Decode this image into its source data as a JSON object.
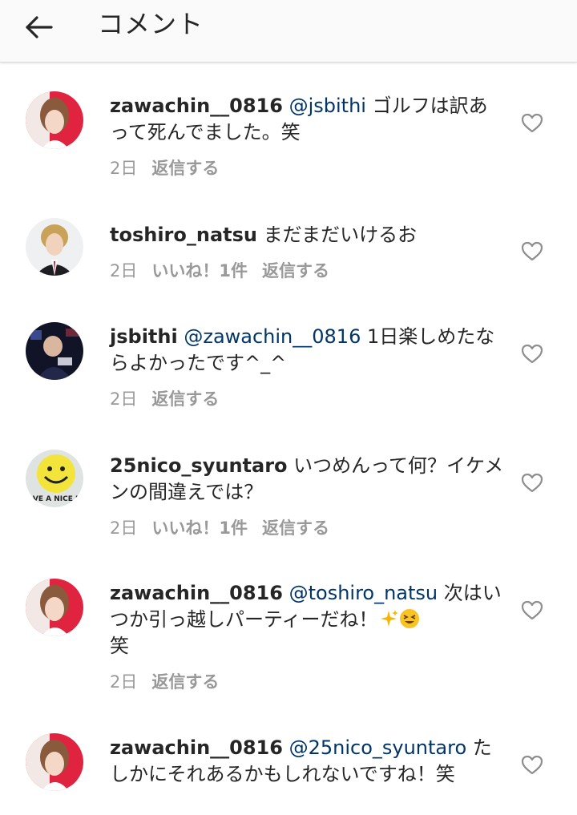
{
  "header": {
    "title": "コメント"
  },
  "comments": [
    {
      "username": "zawachin__0816",
      "mention": "@jsbithi",
      "text": " ゴルフは訳あって死んでました。笑",
      "time": "2日",
      "likes": "",
      "reply": "返信する"
    },
    {
      "username": "toshiro_natsu",
      "mention": "",
      "text": " まだまだいけるお",
      "time": "2日",
      "likes": "いいね！1件",
      "reply": "返信する"
    },
    {
      "username": "jsbithi",
      "mention": "@zawachin__0816",
      "text": " 1日楽しめたならよかったです^_^",
      "time": "2日",
      "likes": "",
      "reply": "返信する"
    },
    {
      "username": "25nico_syuntaro",
      "mention": "",
      "text": " いつめんって何？イケメンの間違えでは？",
      "time": "2日",
      "likes": "いいね！1件",
      "reply": "返信する"
    },
    {
      "username": "zawachin__0816",
      "mention": "@toshiro_natsu",
      "text": " 次はいつか引っ越しパーティーだね！",
      "text_after": "笑",
      "emojis": [
        "sparkles-emoji",
        "squinting-face-emoji"
      ],
      "time": "2日",
      "likes": "",
      "reply": "返信する"
    },
    {
      "username": "zawachin__0816",
      "mention": "@25nico_syuntaro",
      "text": " たしかにそれあるかもしれないですね！笑",
      "time": "",
      "likes": "",
      "reply": ""
    }
  ],
  "avatar_art": {
    "smiley": "AVE A NICE D"
  },
  "colors": {
    "mention": "#003569",
    "meta": "#999999",
    "header_bg": "#fafafa"
  }
}
